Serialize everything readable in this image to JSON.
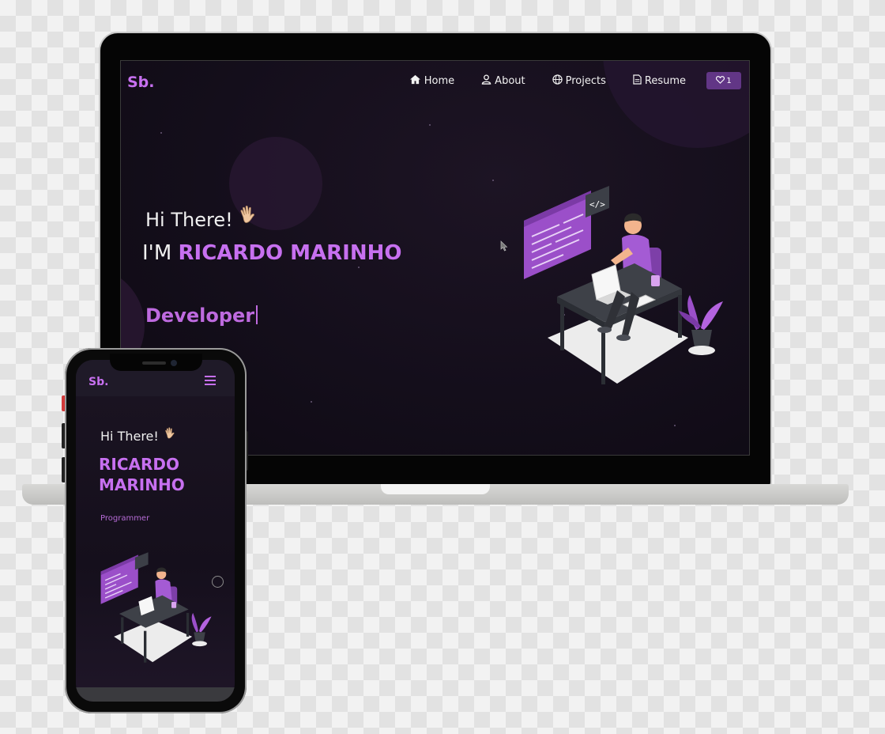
{
  "desktop": {
    "brand": "Sb.",
    "nav": [
      {
        "label": "Home",
        "icon": "home-icon"
      },
      {
        "label": "About",
        "icon": "user-icon"
      },
      {
        "label": "Projects",
        "icon": "globe-icon"
      },
      {
        "label": "Resume",
        "icon": "document-icon"
      }
    ],
    "like_count": "1",
    "greeting": "Hi There!",
    "intro_prefix": "I'M",
    "name": "RICARDO MARINHO",
    "role": "Developer"
  },
  "mobile": {
    "brand": "Sb.",
    "greeting": "Hi There!",
    "name_line1": "RICARDO",
    "name_line2": "MARINHO",
    "role": "Programmer"
  },
  "colors": {
    "accent": "#c770f0",
    "background": "#150f1c",
    "button": "#623686"
  }
}
